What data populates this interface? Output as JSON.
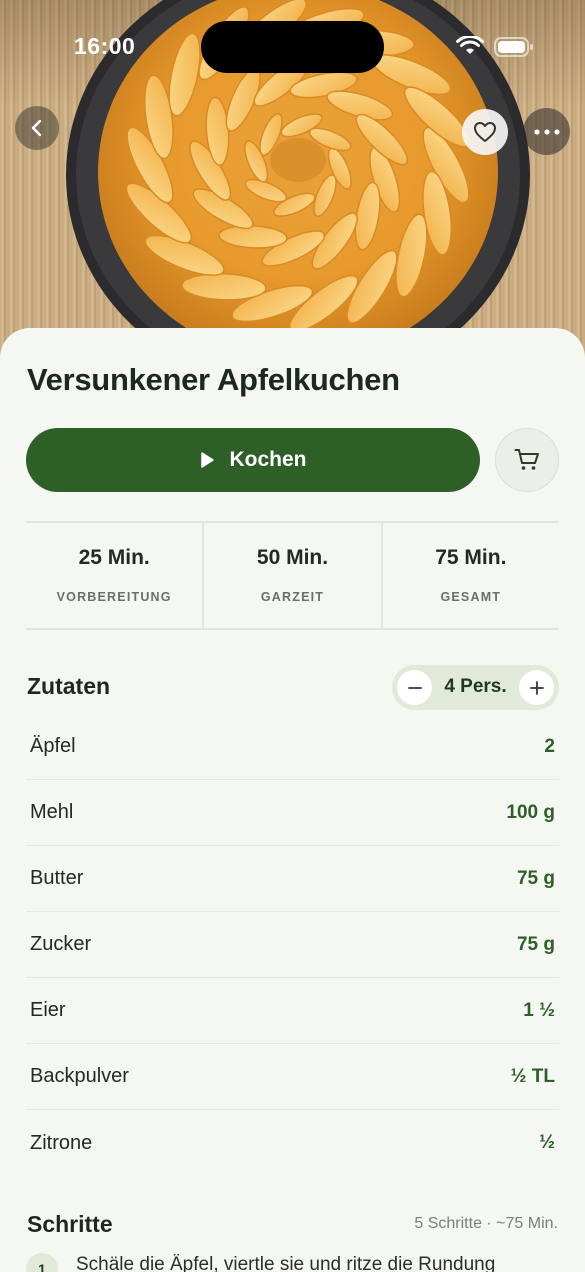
{
  "status_bar": {
    "time": "16:00"
  },
  "hero": {
    "image_alt": "Versunkener Apfelkuchen"
  },
  "recipe": {
    "title": "Versunkener Apfelkuchen",
    "cook_button": "Kochen",
    "times": [
      {
        "value": "25 Min.",
        "label": "VORBEREITUNG"
      },
      {
        "value": "50 Min.",
        "label": "GARZEIT"
      },
      {
        "value": "75 Min.",
        "label": "GESAMT"
      }
    ]
  },
  "ingredients": {
    "title": "Zutaten",
    "servings": "4 Pers.",
    "items": [
      {
        "name": "Äpfel",
        "qty": "2"
      },
      {
        "name": "Mehl",
        "qty": "100 g"
      },
      {
        "name": "Butter",
        "qty": "75 g"
      },
      {
        "name": "Zucker",
        "qty": "75 g"
      },
      {
        "name": "Eier",
        "qty": "1 ½"
      },
      {
        "name": "Backpulver",
        "qty": "½ TL"
      },
      {
        "name": "Zitrone",
        "qty": "½"
      }
    ]
  },
  "steps": {
    "title": "Schritte",
    "meta": "5 Schritte · ~75 Min.",
    "items": [
      {
        "number": "1",
        "text": "Schäle die Äpfel, viertle sie und ritze die Rundung"
      }
    ]
  },
  "icons": {
    "back": "chevron-left-icon",
    "favorite": "heart-icon",
    "more": "ellipsis-icon",
    "cook": "play-icon",
    "cart": "cart-icon",
    "minus": "minus-icon",
    "plus": "plus-icon"
  },
  "colors": {
    "accent": "#2d5f27",
    "background": "#f5f8f2",
    "stepper_bg": "#e1e9d9"
  }
}
